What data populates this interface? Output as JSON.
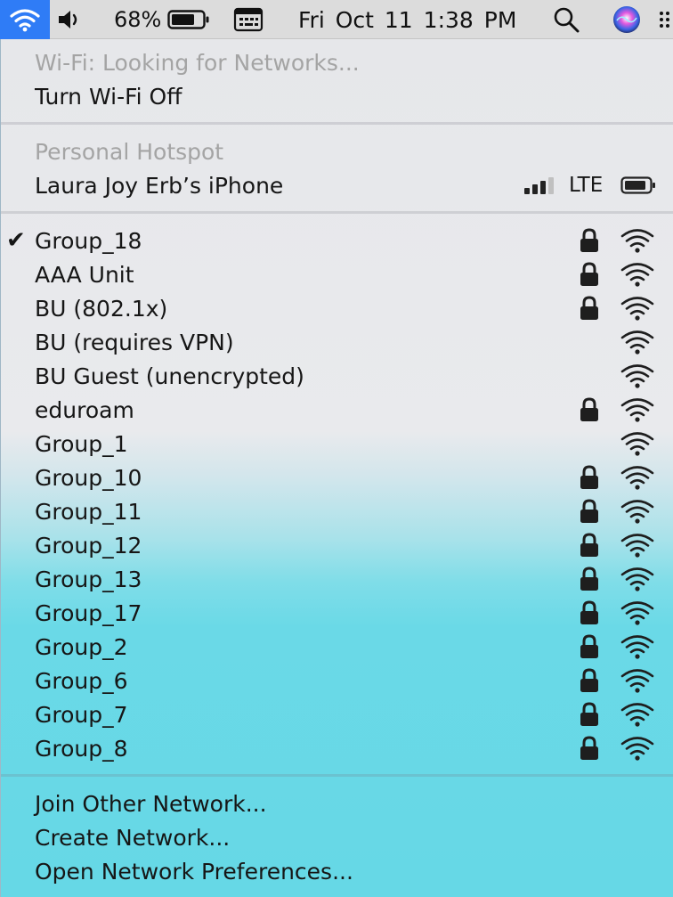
{
  "menubar": {
    "battery_percent": "68%",
    "datetime": "Fri Oct 11  1:38 PM",
    "icons": [
      "wifi-icon",
      "volume-icon",
      "battery-icon",
      "keyboard-icon",
      "search-icon",
      "siri-icon",
      "control-center-icon"
    ]
  },
  "wifi_menu": {
    "status": "Wi-Fi: Looking for Networks...",
    "toggle_label": "Turn Wi-Fi Off",
    "hotspot": {
      "header": "Personal Hotspot",
      "device_name": "Laura Joy Erb’s iPhone",
      "connection_type": "LTE"
    },
    "networks": [
      {
        "name": "Group_18",
        "checked": true,
        "locked": true
      },
      {
        "name": "AAA Unit",
        "checked": false,
        "locked": true
      },
      {
        "name": "BU (802.1x)",
        "checked": false,
        "locked": true
      },
      {
        "name": "BU (requires VPN)",
        "checked": false,
        "locked": false
      },
      {
        "name": "BU Guest (unencrypted)",
        "checked": false,
        "locked": false
      },
      {
        "name": "eduroam",
        "checked": false,
        "locked": true
      },
      {
        "name": "Group_1",
        "checked": false,
        "locked": false
      },
      {
        "name": "Group_10",
        "checked": false,
        "locked": true
      },
      {
        "name": "Group_11",
        "checked": false,
        "locked": true
      },
      {
        "name": "Group_12",
        "checked": false,
        "locked": true
      },
      {
        "name": "Group_13",
        "checked": false,
        "locked": true
      },
      {
        "name": "Group_17",
        "checked": false,
        "locked": true
      },
      {
        "name": "Group_2",
        "checked": false,
        "locked": true
      },
      {
        "name": "Group_6",
        "checked": false,
        "locked": true
      },
      {
        "name": "Group_7",
        "checked": false,
        "locked": true
      },
      {
        "name": "Group_8",
        "checked": false,
        "locked": true
      }
    ],
    "check_mark": "✔",
    "footer": {
      "join_other": "Join Other Network...",
      "create_network": "Create Network...",
      "open_preferences": "Open Network Preferences..."
    }
  },
  "colors": {
    "wifi_button_bg": "#2f7cf6",
    "menubar_bg": "#dcdcdc",
    "disabled_text": "#a4a4a4"
  }
}
